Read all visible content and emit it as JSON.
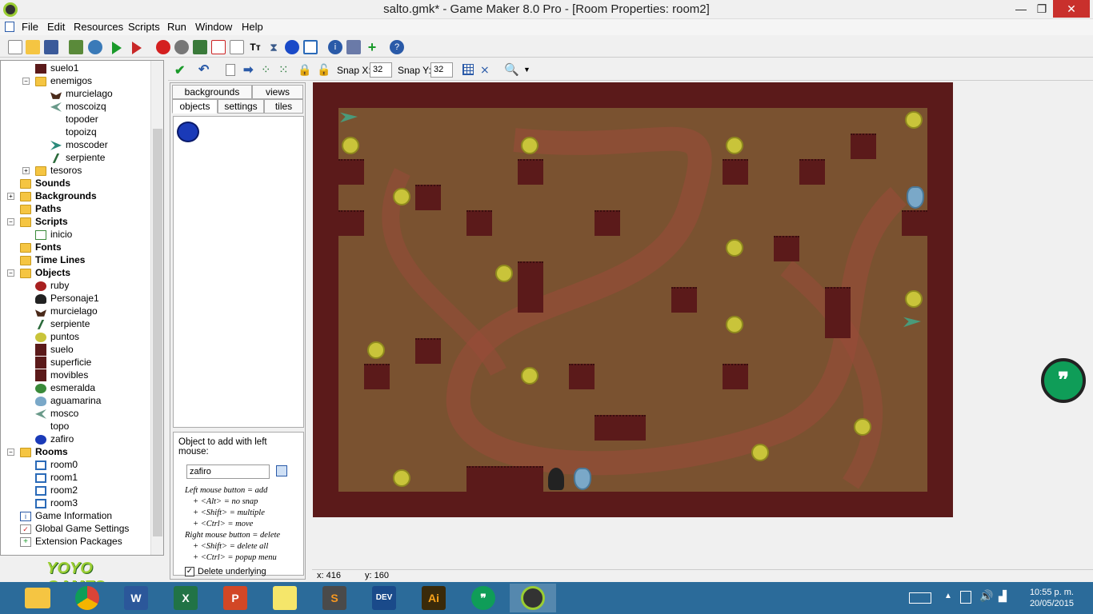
{
  "window": {
    "title": "salto.gmk* - Game Maker 8.0 Pro - [Room Properties: room2]",
    "min": "—",
    "max": "❐",
    "close": "✕"
  },
  "menu": [
    "File",
    "Edit",
    "Resources",
    "Scripts",
    "Run",
    "Window",
    "Help"
  ],
  "tree": {
    "items": [
      {
        "label": "suelo1"
      },
      {
        "label": "enemigos"
      },
      {
        "label": "murcielago"
      },
      {
        "label": "moscoizq"
      },
      {
        "label": "topoder"
      },
      {
        "label": "topoizq"
      },
      {
        "label": "moscoder"
      },
      {
        "label": "serpiente"
      },
      {
        "label": "tesoros"
      },
      {
        "label": "Sounds"
      },
      {
        "label": "Backgrounds"
      },
      {
        "label": "Paths"
      },
      {
        "label": "Scripts"
      },
      {
        "label": "inicio"
      },
      {
        "label": "Fonts"
      },
      {
        "label": "Time Lines"
      },
      {
        "label": "Objects"
      },
      {
        "label": "ruby"
      },
      {
        "label": "Personaje1"
      },
      {
        "label": "murcielago"
      },
      {
        "label": "serpiente"
      },
      {
        "label": "puntos"
      },
      {
        "label": "suelo"
      },
      {
        "label": "superficie"
      },
      {
        "label": "movibles"
      },
      {
        "label": "esmeralda"
      },
      {
        "label": "aguamarina"
      },
      {
        "label": "mosco"
      },
      {
        "label": "topo"
      },
      {
        "label": "zafiro"
      },
      {
        "label": "Rooms"
      },
      {
        "label": "room0"
      },
      {
        "label": "room1"
      },
      {
        "label": "room2"
      },
      {
        "label": "room3"
      },
      {
        "label": "Game Information"
      },
      {
        "label": "Global Game Settings"
      },
      {
        "label": "Extension Packages"
      }
    ],
    "logo": "YOYO GAMES"
  },
  "room_toolbar": {
    "snap_x_label": "Snap X:",
    "snap_x": "32",
    "snap_y_label": "Snap Y:",
    "snap_y": "32"
  },
  "tabs": {
    "backgrounds": "backgrounds",
    "views": "views",
    "objects": "objects",
    "settings": "settings",
    "tiles": "tiles"
  },
  "object_panel": {
    "add_label": "Object to add with left mouse:",
    "selected": "zafiro",
    "hints": [
      "Left mouse button = add",
      "+ <Alt> = no snap",
      "+ <Shift> = multiple",
      "+ <Ctrl> = move",
      "Right mouse button = delete",
      "+ <Shift> = delete all",
      "+ <Ctrl> = popup menu"
    ],
    "delete_underlying": "Delete underlying"
  },
  "status": {
    "x": "x: 416",
    "y": "y: 160"
  },
  "taskbar": {
    "time": "10:55 p. m.",
    "date": "20/05/2015",
    "apps": [
      "Explorer",
      "Chrome",
      "Word",
      "Excel",
      "PowerPoint",
      "Sticky Notes",
      "Sublime",
      "Dev-C++",
      "Illustrator",
      "Hangouts",
      "Game Maker"
    ]
  },
  "colors": {
    "room_wall": "#5b1a1a",
    "room_floor": "#7a5230",
    "coin": "#c9c43a",
    "taskbar": "#2b6b9a"
  }
}
